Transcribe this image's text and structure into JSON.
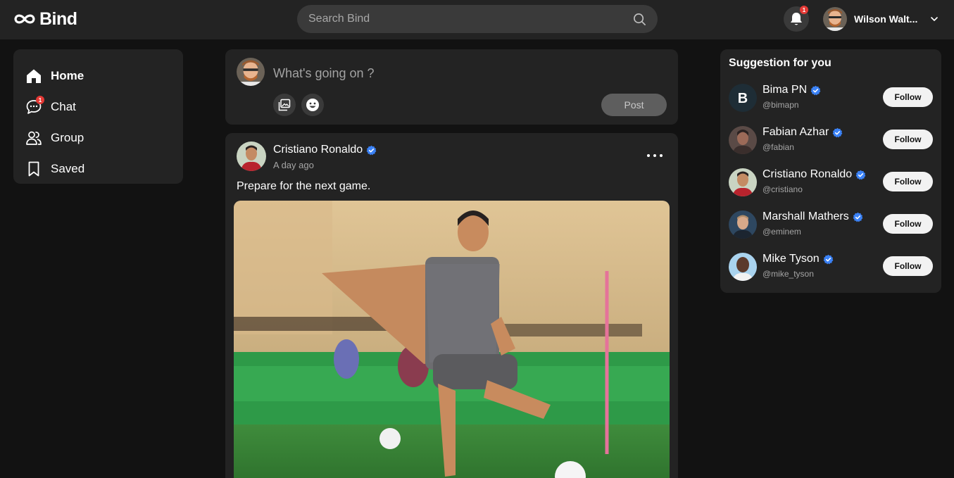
{
  "app": {
    "name": "Bind"
  },
  "header": {
    "search_placeholder": "Search Bind",
    "notification_count": "1",
    "user_name": "Wilson Walt..."
  },
  "sidebar": {
    "items": [
      {
        "label": "Home",
        "icon": "home-icon",
        "active": true
      },
      {
        "label": "Chat",
        "icon": "chat-icon",
        "badge": "1"
      },
      {
        "label": "Group",
        "icon": "group-icon"
      },
      {
        "label": "Saved",
        "icon": "bookmark-icon"
      }
    ]
  },
  "composer": {
    "placeholder": "What's going on ?",
    "post_label": "Post"
  },
  "post": {
    "author": "Cristiano Ronaldo",
    "time": "A day ago",
    "text": "Prepare for the next game."
  },
  "suggestions": {
    "title": "Suggestion for you",
    "follow_label": "Follow",
    "users": [
      {
        "name": "Bima PN",
        "handle": "@bimapn"
      },
      {
        "name": "Fabian Azhar",
        "handle": "@fabian"
      },
      {
        "name": "Cristiano Ronaldo",
        "handle": "@cristiano"
      },
      {
        "name": "Marshall Mathers",
        "handle": "@eminem"
      },
      {
        "name": "Mike Tyson",
        "handle": "@mike_tyson"
      }
    ]
  },
  "colors": {
    "background": "#121212",
    "card": "#232323",
    "verified": "#3b82f6",
    "badge": "#e53935"
  }
}
